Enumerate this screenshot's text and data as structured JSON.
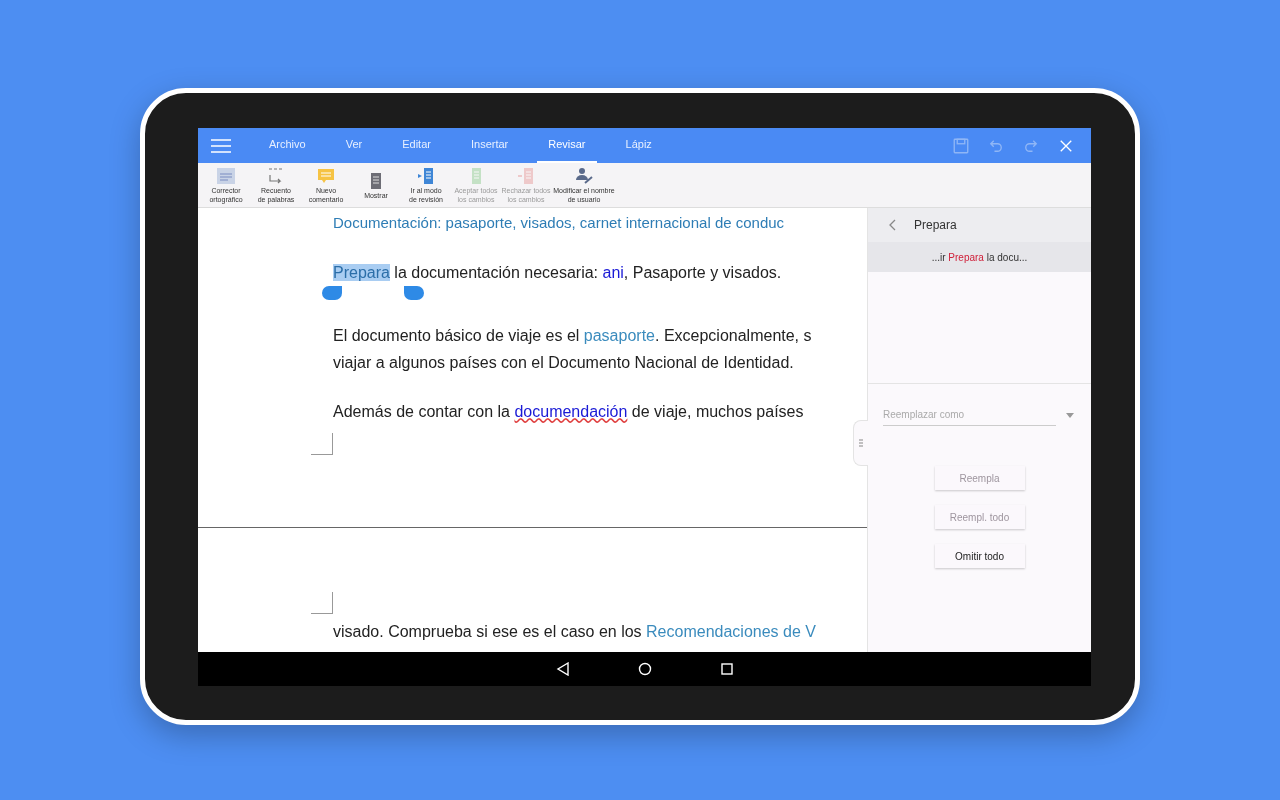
{
  "menu": {
    "tabs": [
      {
        "label": "Archivo",
        "selected": false
      },
      {
        "label": "Ver",
        "selected": false
      },
      {
        "label": "Editar",
        "selected": false
      },
      {
        "label": "Insertar",
        "selected": false
      },
      {
        "label": "Revisar",
        "selected": true
      },
      {
        "label": "Lápiz",
        "selected": false
      }
    ],
    "actions": [
      {
        "kind": "save",
        "disabled": true
      },
      {
        "kind": "undo",
        "disabled": true
      },
      {
        "kind": "redo",
        "disabled": true
      },
      {
        "kind": "close",
        "disabled": false
      }
    ]
  },
  "toolbar": {
    "tools": [
      {
        "kind": "spellcheck",
        "lines": [
          "Corrector",
          "ortográfico"
        ],
        "disabled": false
      },
      {
        "kind": "wordcount",
        "lines": [
          "Recuento",
          "de palabras"
        ],
        "disabled": false
      },
      {
        "kind": "comment",
        "lines": [
          "Nuevo",
          "comentario"
        ],
        "disabled": false
      },
      {
        "kind": "show",
        "lines": [
          "Mostrar"
        ],
        "disabled": false
      },
      {
        "kind": "review",
        "lines": [
          "Ir al modo",
          "de revisión"
        ],
        "disabled": false
      },
      {
        "kind": "accept",
        "lines": [
          "Aceptar todos",
          "los cambios"
        ],
        "disabled": true
      },
      {
        "kind": "reject",
        "lines": [
          "Rechazar todos",
          "los cambios"
        ],
        "disabled": true
      },
      {
        "kind": "user",
        "lines": [
          "Modificar el nombre",
          "de usuario"
        ],
        "disabled": false
      }
    ]
  },
  "document": {
    "heading": "Documentación: pasaporte, visados, carnet internacional de conduc",
    "paragraphs": [
      {
        "lines": [
          [
            {
              "kind": "selected",
              "text": "Prepara"
            },
            {
              "kind": "plain",
              "text": " la documentación necesaria: "
            },
            {
              "kind": "link",
              "text": "ani"
            },
            {
              "kind": "plain",
              "text": ", Pasaporte y visados."
            }
          ]
        ]
      },
      {
        "lines": [
          [
            {
              "kind": "plain",
              "text": "El documento básico de viaje es el "
            },
            {
              "kind": "term",
              "text": "pasaporte"
            },
            {
              "kind": "plain",
              "text": ". Excepcionalmente, s"
            }
          ],
          [
            {
              "kind": "plain",
              "text": "viajar a algunos países con el Documento Nacional de Identidad."
            }
          ]
        ]
      },
      {
        "lines": [
          [
            {
              "kind": "plain",
              "text": "Además de contar con la "
            },
            {
              "kind": "misspelled",
              "text": "documendación"
            },
            {
              "kind": "plain",
              "text": " de viaje, muchos países"
            }
          ]
        ]
      }
    ],
    "next_page": [
      {
        "kind": "plain",
        "text": "visado. Comprueba si ese es el caso en los "
      },
      {
        "kind": "term",
        "text": "Recomendaciones de V"
      }
    ]
  },
  "panel": {
    "title": "Prepara",
    "context": {
      "before": "...ir ",
      "match": "Prepara",
      "after": " la docu..."
    },
    "replace": {
      "placeholder": "Reemplazar como"
    },
    "buttons": [
      {
        "label": "Reempla",
        "disabled": true
      },
      {
        "label": "Reempl. todo",
        "disabled": true
      },
      {
        "label": "Omitir todo",
        "disabled": false
      }
    ]
  }
}
